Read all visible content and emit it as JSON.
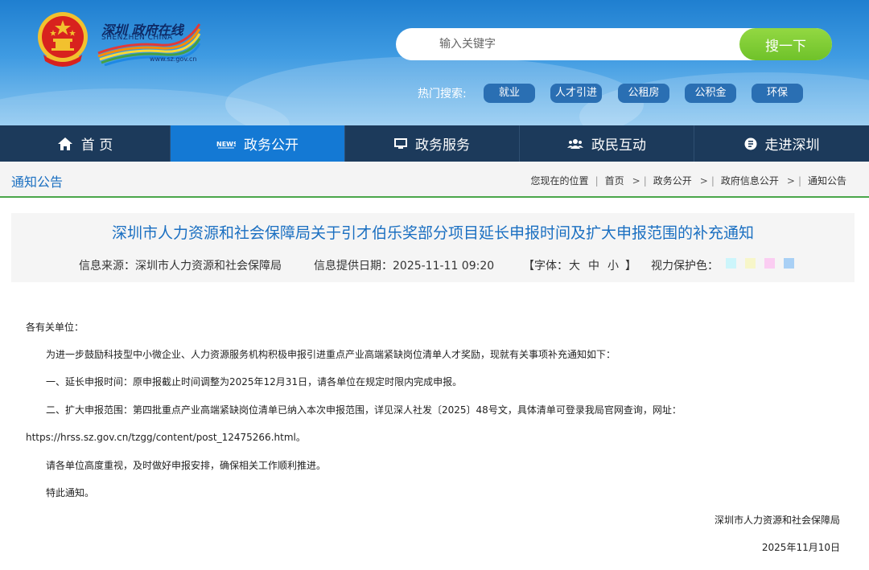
{
  "header": {
    "logo_cn": "深圳 政府在线",
    "logo_en": "SHENZHEN CHINA",
    "logo_url": "www.sz.gov.cn",
    "search": {
      "placeholder": "输入关键字",
      "button": "搜一下"
    },
    "hot_label": "热门搜索:",
    "hot_tags": [
      "就业",
      "人才引进",
      "公租房",
      "公积金",
      "环保"
    ]
  },
  "nav": [
    {
      "label": "首 页",
      "icon": "home-icon"
    },
    {
      "label": "政务公开",
      "icon": "news-icon",
      "active": true
    },
    {
      "label": "政务服务",
      "icon": "monitor-icon"
    },
    {
      "label": "政民互动",
      "icon": "people-icon"
    },
    {
      "label": "走进深圳",
      "icon": "info-icon"
    }
  ],
  "breadcrumb": {
    "section": "通知公告",
    "location_label": "您现在的位置",
    "items": [
      "首页",
      "政务公开",
      "政府信息公开",
      "通知公告"
    ]
  },
  "article": {
    "title": "深圳市人力资源和社会保障局关于引才伯乐奖部分项目延长申报时间及扩大申报范围的补充通知",
    "source": "信息来源：深圳市人力资源和社会保障局",
    "date": "信息提供日期：2025-11-11 09:20",
    "font_size_label": "【字体：",
    "font_sizes": [
      "大",
      "中",
      "小"
    ],
    "font_size_close": "】",
    "eye_care_label": "视力保护色：",
    "eye_care_colors": [
      "#ccf5fb",
      "#f7f6c9",
      "#fbcdf2",
      "#a9d0f5"
    ],
    "body": [
      "各有关单位：",
      "为进一步鼓励科技型中小微企业、人力资源服务机构积极申报引进重点产业高端紧缺岗位清单人才奖励，现就有关事项补充通知如下：",
      "一、延长申报时间：原申报截止时间调整为2025年12月31日，请各单位在规定时限内完成申报。",
      "二、扩大申报范围：第四批重点产业高端紧缺岗位清单已纳入本次申报范围，详见深人社发〔2025〕48号文，具体清单可登录我局官网查询，网址：",
      "https://hrss.sz.gov.cn/tzgg/content/post_12475266.html。",
      "请各单位高度重视，及时做好申报安排，确保相关工作顺利推进。",
      "特此通知。"
    ],
    "signature": "深圳市人力资源和社会保障局",
    "sign_date": "2025年11月10日"
  },
  "colors": {
    "nav_bg": "#1c3a5b",
    "nav_active": "#1479d4",
    "accent_blue": "#1a6fc1",
    "search_green": "#7cc832",
    "divider_green": "#4aa64a"
  }
}
